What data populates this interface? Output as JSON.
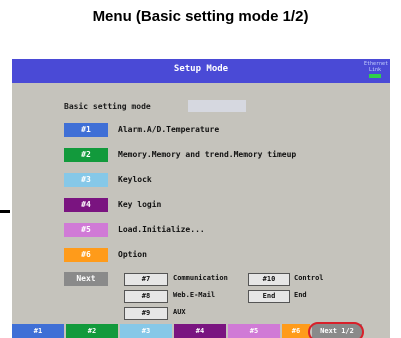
{
  "caption": "Menu (Basic setting mode 1/2)",
  "window": {
    "title": "Setup Mode",
    "ethernet_label": "Ethernet",
    "link_label": "Link"
  },
  "section_title": "Basic setting mode",
  "menu_items": [
    {
      "key": "#1",
      "label": "Alarm.A/D.Temperature",
      "color": "#3f6fd6"
    },
    {
      "key": "#2",
      "label": "Memory.Memory and trend.Memory timeup",
      "color": "#129a3c"
    },
    {
      "key": "#3",
      "label": "Keylock",
      "color": "#86c8e8"
    },
    {
      "key": "#4",
      "label": "Key login",
      "color": "#7a1480"
    },
    {
      "key": "#5",
      "label": "Load.Initialize...",
      "color": "#d07ad6"
    },
    {
      "key": "#6",
      "label": "Option",
      "color": "#ff9b1a"
    }
  ],
  "next": {
    "key": "Next",
    "subitems": [
      {
        "key": "#7",
        "label": "Communication"
      },
      {
        "key": "#10",
        "label": "Control"
      },
      {
        "key": "#8",
        "label": "Web.E-Mail"
      },
      {
        "key": "End",
        "label": "End"
      },
      {
        "key": "#9",
        "label": "AUX"
      }
    ]
  },
  "softkeys": [
    {
      "label": "#1",
      "color": "#3f6fd6"
    },
    {
      "label": "#2",
      "color": "#129a3c"
    },
    {
      "label": "#3",
      "color": "#86c8e8"
    },
    {
      "label": "#4",
      "color": "#7a1480"
    },
    {
      "label": "#5",
      "color": "#d07ad6"
    },
    {
      "label": "#6",
      "color": "#ff9b1a"
    },
    {
      "label": "Next 1/2",
      "color": "#8a8a8a"
    }
  ]
}
